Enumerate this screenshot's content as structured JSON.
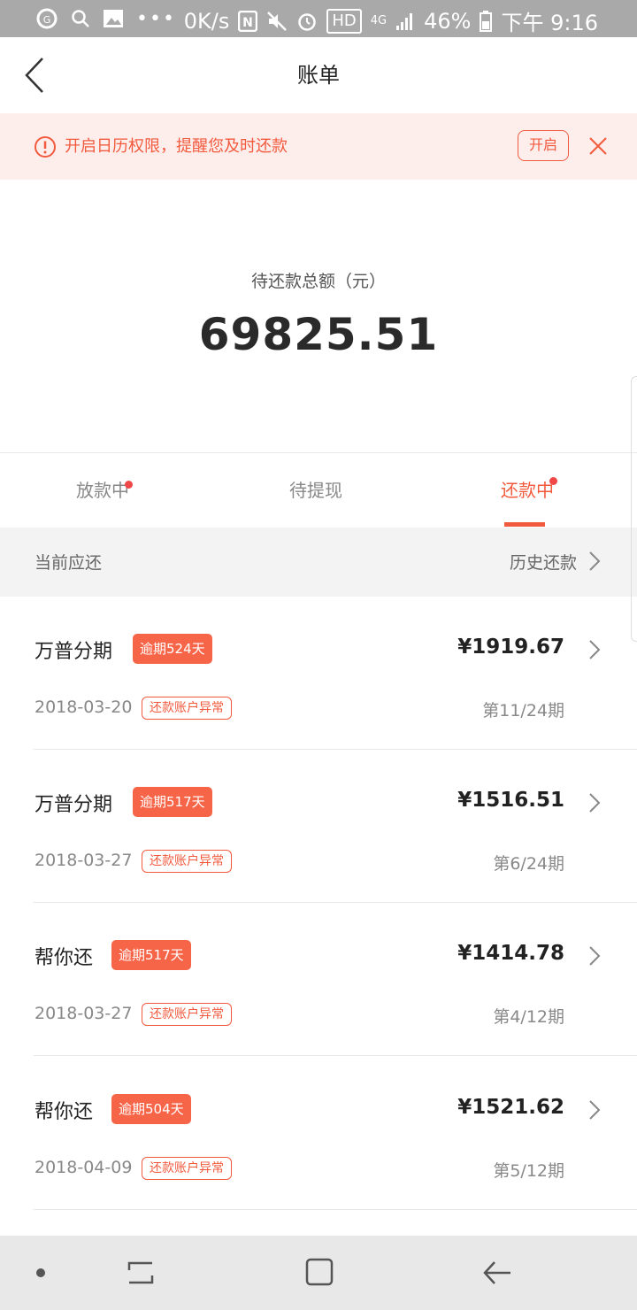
{
  "statusbar": {
    "net_speed": "0K/s",
    "hd": "HD",
    "network": "4G",
    "battery": "46%",
    "time": "下午 9:16"
  },
  "header": {
    "title": "账单"
  },
  "banner": {
    "text": "开启日历权限，提醒您及时还款",
    "button": "开启"
  },
  "summary": {
    "label": "待还款总额（元）",
    "amount": "69825.51"
  },
  "tabs": [
    {
      "label": "放款中",
      "dot": true,
      "active": false
    },
    {
      "label": "待提现",
      "dot": false,
      "active": false
    },
    {
      "label": "还款中",
      "dot": true,
      "active": true
    }
  ],
  "section": {
    "current": "当前应还",
    "history": "历史还款"
  },
  "bills": [
    {
      "name": "万普分期",
      "overdue": "逾期524天",
      "amount": "¥1919.67",
      "date": "2018-03-20",
      "tag": "还款账户异常",
      "period": "第11/24期"
    },
    {
      "name": "万普分期",
      "overdue": "逾期517天",
      "amount": "¥1516.51",
      "date": "2018-03-27",
      "tag": "还款账户异常",
      "period": "第6/24期"
    },
    {
      "name": "帮你还",
      "overdue": "逾期517天",
      "amount": "¥1414.78",
      "date": "2018-03-27",
      "tag": "还款账户异常",
      "period": "第4/12期"
    },
    {
      "name": "帮你还",
      "overdue": "逾期504天",
      "amount": "¥1521.62",
      "date": "2018-04-09",
      "tag": "还款账户异常",
      "period": "第5/12期"
    }
  ],
  "colors": {
    "accent": "#f25a3e",
    "badge": "#f76549",
    "banner_bg": "#fdeeec",
    "statusbar_bg": "#a9a9a9"
  }
}
